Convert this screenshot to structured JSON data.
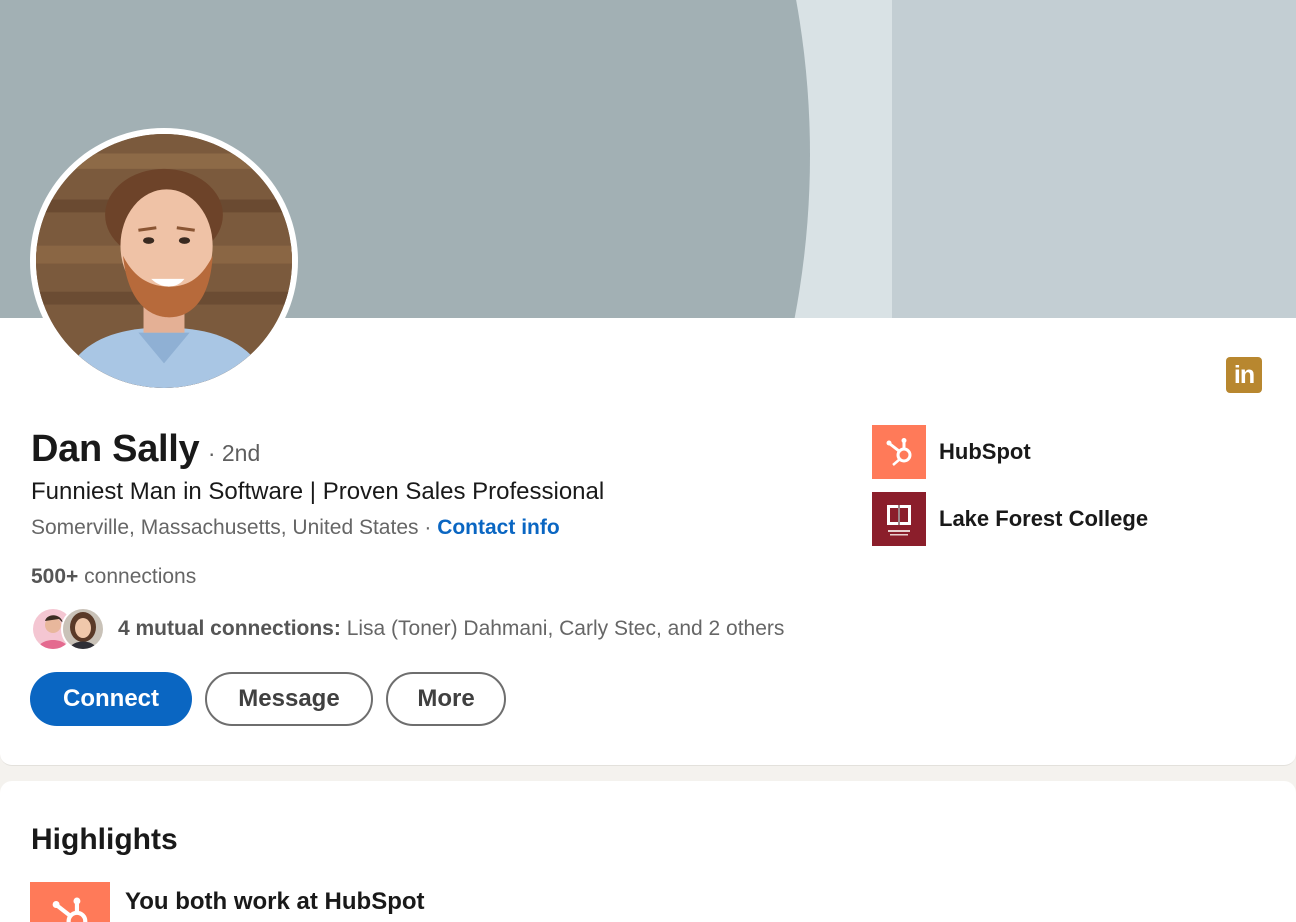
{
  "profile": {
    "name": "Dan Sally",
    "degree": "· 2nd",
    "headline": "Funniest Man in Software | Proven Sales Professional",
    "location": "Somerville, Massachusetts, United States",
    "location_separator": "·",
    "contact_link": "Contact info",
    "connections_count": "500+",
    "connections_label": "connections",
    "mutual": {
      "label": "4 mutual connections:",
      "names": "Lisa (Toner) Dahmani, Carly Stec, and 2 others"
    },
    "brand_badge": "in",
    "brand_badge_color": "#b8872f",
    "organizations": [
      {
        "name": "HubSpot",
        "logo": "hubspot-logo",
        "color": "#ff7a59"
      },
      {
        "name": "Lake Forest College",
        "logo": "lake-forest-college-logo",
        "color": "#8b1e2b"
      }
    ]
  },
  "actions": {
    "connect": "Connect",
    "message": "Message",
    "more": "More"
  },
  "highlights": {
    "title": "Highlights",
    "items": [
      {
        "text": "You both work at HubSpot",
        "logo": "hubspot-logo"
      }
    ]
  },
  "colors": {
    "accent": "#0a66c2",
    "hubspot": "#ff7a59",
    "cover": "#a2b0b4"
  }
}
